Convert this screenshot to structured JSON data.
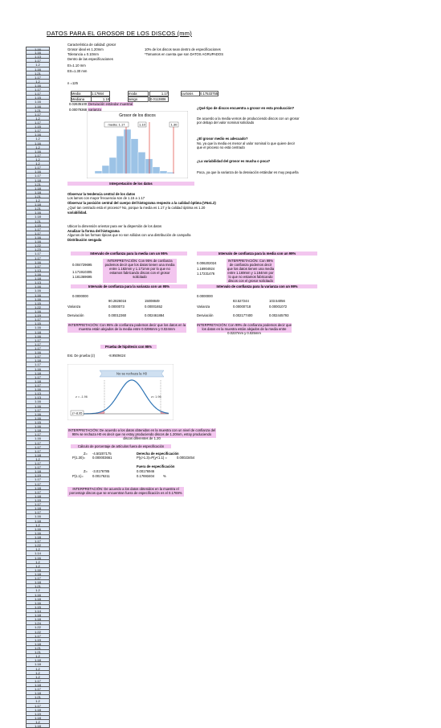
{
  "title": "DATOS PARA EL GROSOR DE LOS DISCOS (mm)",
  "intro": {
    "characteristic": "Característica de calidad: grosor",
    "nominal": "Grosor ideal es 1.20mm",
    "tolerance": "Tolerancia ± 0.10mm",
    "within": "Dentro de las especificaciones",
    "ei": "EI=1.10 mm",
    "es": "ES=1.30 mm",
    "n": "n =125",
    "pct_within": "10% de los discos sean dentro de especificaciones",
    "note": "*Tomamos en cuenta que son DATOS AGRUPADOS"
  },
  "rows": [
    "1.16",
    "1.16",
    "1.13",
    "1.17",
    "1.2",
    "1.16",
    "1.21",
    "1.17",
    "1.2",
    "1.16",
    "1.17",
    "1.17",
    "1.15",
    "1.16",
    "1.16",
    "1.21",
    "1.17",
    "1.2",
    "1.17",
    "1.15",
    "1.17",
    "1.16",
    "1.2",
    "1.16",
    "1.2",
    "1.16",
    "1.17",
    "1.2",
    "1.2",
    "1.17",
    "1.16",
    "1.17",
    "1.18",
    "1.21",
    "1.18",
    "1.18",
    "1.21",
    "1.2",
    "1.18",
    "1.21",
    "1.16",
    "1.18",
    "1.21",
    "1.15",
    "1.17",
    "1.17",
    "1.16",
    "1.16",
    "1.22",
    "1.23",
    "1.17",
    "1.17",
    "1.16",
    "1.17",
    "1.13",
    "1.16",
    "1.18",
    "1.13",
    "1.16",
    "1.16",
    "1.16",
    "1.16",
    "1.15",
    "1.22",
    "1.16",
    "1.19",
    "1.17",
    "1.15",
    "1.16",
    "1.18",
    "1.16",
    "1.17",
    "1.17",
    "1.17",
    "1.16",
    "1.17",
    "1.18",
    "1.17",
    "1.16",
    "1.18",
    "1.17",
    "1.18",
    "1.17",
    "1.16",
    "1.13",
    "1.13",
    "1.16",
    "1.16",
    "1.17",
    "1.16",
    "1.16",
    "1.15",
    "1.16",
    "1.18",
    "1.17",
    "1.16",
    "1.17",
    "1.17",
    "1.17",
    "1.18",
    "1.2",
    "1.17",
    "1.17",
    "1.18",
    "1.19",
    "1.17",
    "1.17",
    "1.18",
    "1.17",
    "1.18",
    "1.19",
    "1.17",
    "1.18",
    "1.17",
    "1.16",
    "1.18",
    "1.2",
    "1.16",
    "1.16",
    "1.18",
    "1.17",
    "1.22",
    "1.2",
    "1.14",
    "1.16",
    "1.2",
    "1.2",
    "1.16",
    "1.18",
    "1.17",
    "1.18",
    "1.21",
    "1.2",
    "1.16",
    "1.18",
    "1.16",
    "1.15",
    "1.14",
    "1.18",
    "1.18",
    "1.24",
    "1.22",
    "1.22",
    "1.17",
    "1.19",
    "1.18",
    "1.21",
    "1.21",
    "1.2",
    "1.18",
    "1.18",
    "1.2",
    "1.2",
    "1.2",
    "1.17",
    "1.18",
    "1.17",
    "1.18",
    "1.21",
    "1.2",
    "1.17",
    "1.18",
    "1.19",
    "1.18",
    "1.2",
    "1.18"
  ],
  "stats": {
    "media_label": "Media",
    "media_val": "1.17664",
    "moda_label": "moda",
    "moda_val": "1.17",
    "curtosis_label": "curtosis",
    "curtosis_val": "0.17533755",
    "mediana_label": "Mediana",
    "mediana_val": "1.18",
    "sesgo_label": "sesgo",
    "sesgo_val": "0.0113806",
    "desv_val": "0.026351001",
    "desv_label": "Desviación estándar muestral",
    "var_val": "0.00079368",
    "var_label": "varianza"
  },
  "hist": {
    "title": "Grosor de los discos",
    "label_media": "media: 1.17",
    "label_ei": "1.10",
    "label_es": "1.30",
    "bars": [
      2,
      6,
      12,
      28,
      33,
      26,
      16,
      11,
      5,
      2,
      1
    ]
  },
  "questions": {
    "q1": "¿Qué tipo de discos encuentra a grosor en esta producción?",
    "a1": "De acuerdo a la media vemos de producciendo discos con un grosor por debajo del valor nominal solicitado",
    "q2": "¿El grosor medio es adecuado?",
    "a2": "No, ya que la media es menor al valor nominal lo que quiere decir que el proceso no está centrado",
    "q3": "¿La variabilidad del grosor es mucha o poca?",
    "a3": "Poca, ya que la varianza de la desviación estándar es muy pequeña"
  },
  "interp1": {
    "header": "Interpretación de los datos",
    "l1": "Observar la tendencia central de los datos",
    "l2": "Los lamos con mayor frecuencia son de 1.15 a 1.17",
    "l3": "Observar la posición central del cuerpo del histograma respecto a la calidad óptima (VN±1.2)",
    "l4": "¿Qué tan centrado está el proceso? No, porque la media es 1.17 y la calidad óptima es 1.20",
    "l5": "variabilidad.",
    "l6": "Ubicar la dimensión orientar para ver la dispersión de los datos",
    "l7": "Analizar la forma del histograma",
    "l8": "Algunos de las formas típicas que no son sólidas con una distribución de campaña",
    "l9": "Distribución sesgada"
  },
  "ci": {
    "h95": "Intervalo de confianza para la media con un 95%",
    "h99": "Intervalo de confianza para la media con un 99%",
    "m95_a": "0.004729695",
    "m95_b": "1.171910305",
    "m95_c": "1.181369695",
    "m99_a": "0.006202024",
    "m99_b": "1.16904924",
    "m99_c": "1.17231476",
    "i95_text": "INTERPRETACIÓN: Con 95% de confianza podemos decir que los datos tienen una media entre 1.182mm y 1.171mm por lo que no estamos fabricando discos con el grosor solicitado",
    "i99_text": "INTERPRETACIÓN: Con 99% de confianza podemos decir que los datos tienen una media entre 1.169mm y 1.184mm por lo que no estamos fabricando discos con el grosor solicitado",
    "hv95": "Intervalo de confianza para la varianza con un 95%",
    "hv99": "Intervalo de confianza para la varianza con un 99%",
    "v95_n": "0.0000000",
    "v95_r1": "90.2826016",
    "v95_r2": "15008849",
    "v99_n": "0.0000000",
    "v99_r1": "83.527244",
    "v99_r2": "103.54056",
    "var_label": "Varianza",
    "v95_v1": "0.0000073",
    "v95_v2": "0.00001652",
    "v99_v1": "0.00000718",
    "v99_v2": "0.00001072",
    "desv_label": "Desviación",
    "d95_1": "0.00012360",
    "d95_2": "0.002461884",
    "d99_1": "0.002177400",
    "d99_2": "0.002445793",
    "iv95_text": "INTERPRETACIÓN: Con 95% de confianza podemos decir que los datos en la muestra están alejados de la media entre 0.0296mm y 0.024mm",
    "iv99_text": "INTERPRETACIÓN: Con 99% de confianza podemos decir que los datos en la muestra están alejados de la media entre 0.0237mm y 0.025mm"
  },
  "hyp": {
    "header": "Prueba de hipótesis con 95%",
    "stat_label": "Est. De prueba (z)",
    "stat_val": "-8.9509424",
    "curve_label": "No se rechaza la H0",
    "z_left": "z = -1.96",
    "z_right": "z= 1.96",
    "z_obs": "z=-8.95",
    "interp": "INTERPRETACIÓN: De acuerdo a los datos obtenidos en la muestra con un nivel de confianza del 95% se rechaza H0 es decir que no estoy produciendo discos de 1.20mm, estoy produciendo discos diferentes de 1.20"
  },
  "out": {
    "header": "Cálculo de porcentaje de artículos fuera de especificación",
    "z1_label": "Z=",
    "z1_val": "-4.50207175",
    "der_label": "Derecha de especificación",
    "p1_label": "P(1.30)=",
    "p1_val": "0.000003661",
    "p_formula": "P(y>1.3)=P(y<1.1) =",
    "p_formula_val": "0.00023454",
    "fuera_label": "Fuera de especificación",
    "z2_label": "Z=",
    "z2_val": "-3.0176785",
    "fuera_val": "0.00176946",
    "p2_label": "P(1.1)=",
    "p2_val": "0.00176211",
    "pct_val": "0.17693404",
    "pct_unit": "%",
    "interp": "INTERPRETACIÓN: De acuerdo a los datos obtenidos en la muestra el porcentaje discos que se encuentran fuera de especificación es el 0.1769%"
  },
  "colors": {
    "pink": "#f3c6ef",
    "row_bg": "#dfe9f6",
    "bar": "#9cc3e6",
    "curve": "#2e74b5",
    "redline": "#e0433c"
  }
}
